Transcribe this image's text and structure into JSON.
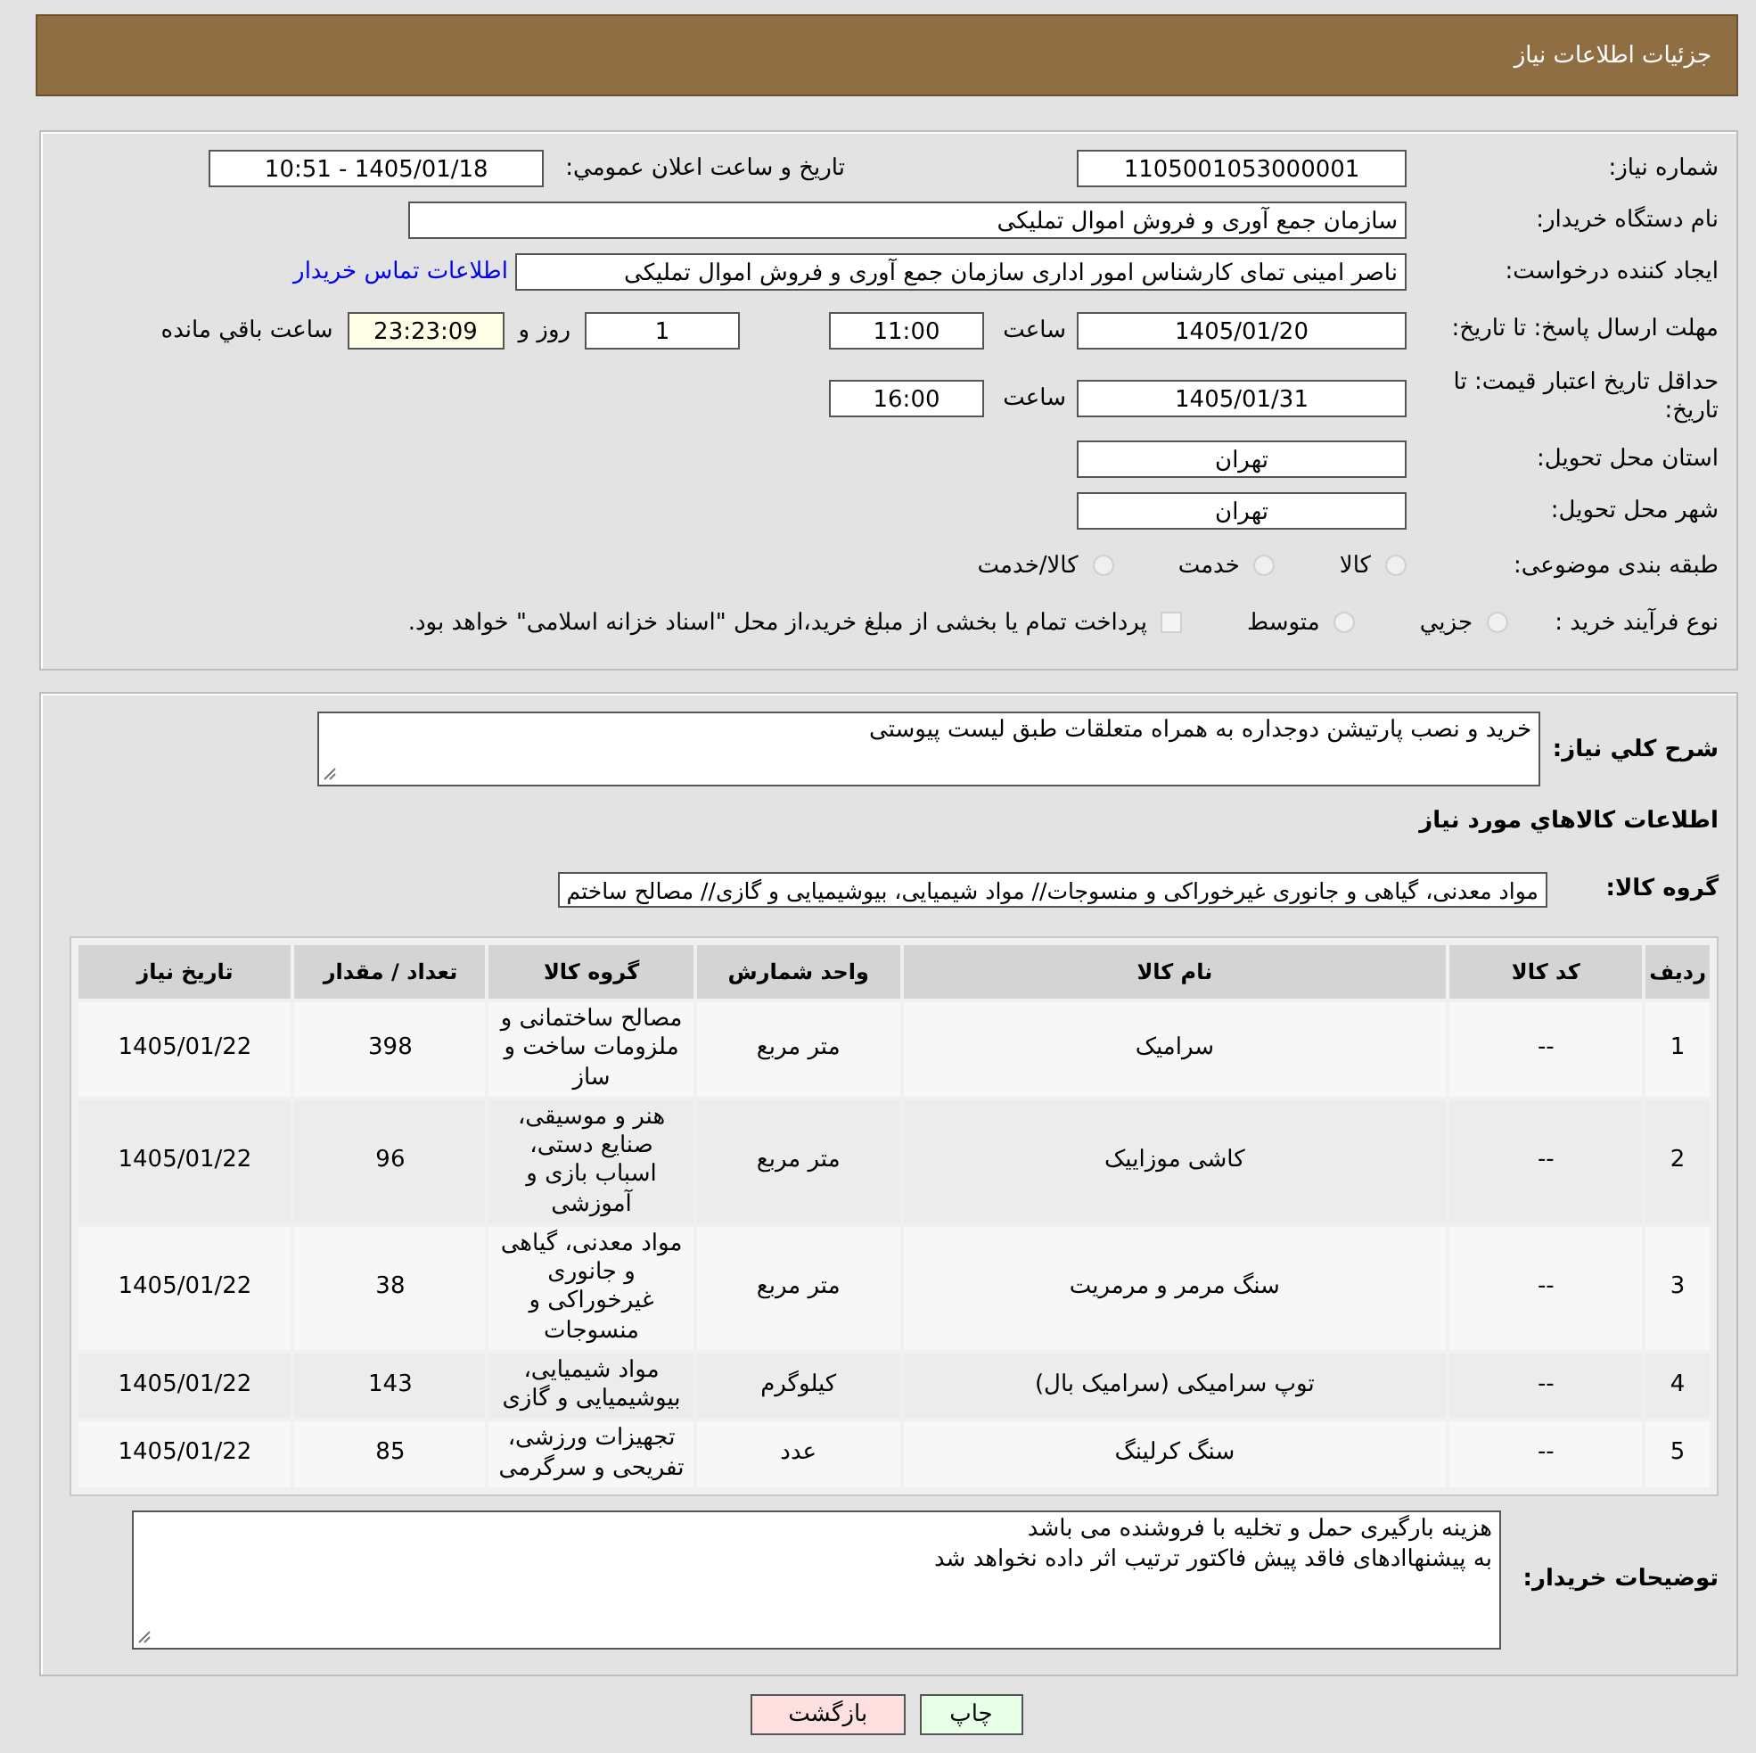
{
  "header": {
    "title": "جزئیات اطلاعات نیاز"
  },
  "need_number": {
    "label": "شماره نیاز:",
    "value": "1105001053000001"
  },
  "announce": {
    "label": "تاریخ و ساعت اعلان عمومي:",
    "value": "1405/01/18 - 10:51"
  },
  "buyer_org": {
    "label": "نام دستگاه خریدار:",
    "value": "سازمان جمع آوری و فروش اموال تملیکی"
  },
  "requester": {
    "label": "ایجاد کننده درخواست:",
    "value": "ناصر امینی تمای کارشناس امور اداری سازمان جمع آوری و فروش اموال تملیکی",
    "link": "اطلاعات تماس خریدار"
  },
  "deadline": {
    "label": "مهلت ارسال پاسخ: تا تاریخ:",
    "date": "1405/01/20",
    "time_label": "ساعت",
    "time": "11:00",
    "days": "1",
    "days_label": "روز و",
    "remaining": "23:23:09",
    "remaining_label": "ساعت باقي مانده"
  },
  "validity": {
    "label": "حداقل تاریخ اعتبار قیمت: تا تاریخ:",
    "date": "1405/01/31",
    "time_label": "ساعت",
    "time": "16:00"
  },
  "province": {
    "label": "استان محل تحویل:",
    "value": "تهران"
  },
  "city": {
    "label": "شهر محل تحویل:",
    "value": "تهران"
  },
  "category": {
    "label": "طبقه بندی موضوعی:",
    "options": [
      {
        "label": "کالا",
        "selected": false
      },
      {
        "label": "خدمت",
        "selected": false
      },
      {
        "label": "کالا/خدمت",
        "selected": false
      }
    ]
  },
  "process": {
    "label": "نوع فرآیند خرید :",
    "options": [
      {
        "label": "جزيي",
        "selected": false
      },
      {
        "label": "متوسط",
        "selected": false
      }
    ],
    "payment": {
      "label": "پرداخت تمام یا بخشی از مبلغ خرید،از محل \"اسناد خزانه اسلامی\" خواهد بود.",
      "checked": false
    }
  },
  "description": {
    "label": "شرح کلي نیاز:",
    "value": "خرید و نصب پارتیشن دوجداره به همراه متعلقات  طبق لیست پیوستی"
  },
  "items_heading": "اطلاعات کالاهاي مورد نیاز",
  "goods_group": {
    "label": "گروه کالا:",
    "value": "مواد معدنی، گیاهی و جانوری غیرخوراکی و منسوجات// مواد شیمیایی، بیوشیمیایی و  گازی// مصالح ساختم"
  },
  "table": {
    "columns": [
      "ردیف",
      "کد کالا",
      "نام کالا",
      "واحد شمارش",
      "گروه کالا",
      "تعداد / مقدار",
      "تاریخ نیاز"
    ],
    "rows": [
      [
        "1",
        "--",
        "سرامیک",
        "متر مربع",
        "مصالح ساختمانی و ملزومات ساخت و ساز",
        "398",
        "1405/01/22"
      ],
      [
        "2",
        "--",
        "کاشی موزاییک",
        "متر مربع",
        "هنر و موسیقی، صنایع دستی، اسباب بازی و آموزشی",
        "96",
        "1405/01/22"
      ],
      [
        "3",
        "--",
        "سنگ مرمر و مرمریت",
        "متر مربع",
        "مواد معدنی، گیاهی و جانوری غیرخوراکی و منسوجات",
        "38",
        "1405/01/22"
      ],
      [
        "4",
        "--",
        "توپ سرامیکی (سرامیک بال)",
        "کیلوگرم",
        "مواد شیمیایی، بیوشیمیایی و گازی",
        "143",
        "1405/01/22"
      ],
      [
        "5",
        "--",
        "سنگ کرلینگ",
        "عدد",
        "تجهیزات ورزشی، تفریحی و سرگرمی",
        "85",
        "1405/01/22"
      ]
    ]
  },
  "buyer_notes": {
    "label": "توضیحات خریدار:",
    "value": "هزینه بارگیری حمل و تخلیه با فروشنده می باشد\nبه پیشنهاادهای فاقد پیش فاکتور ترتیب اثر داده نخواهد شد"
  },
  "buttons": [
    {
      "label": "چاپ",
      "kind": "print"
    },
    {
      "label": "بازگشت",
      "kind": "back"
    }
  ]
}
